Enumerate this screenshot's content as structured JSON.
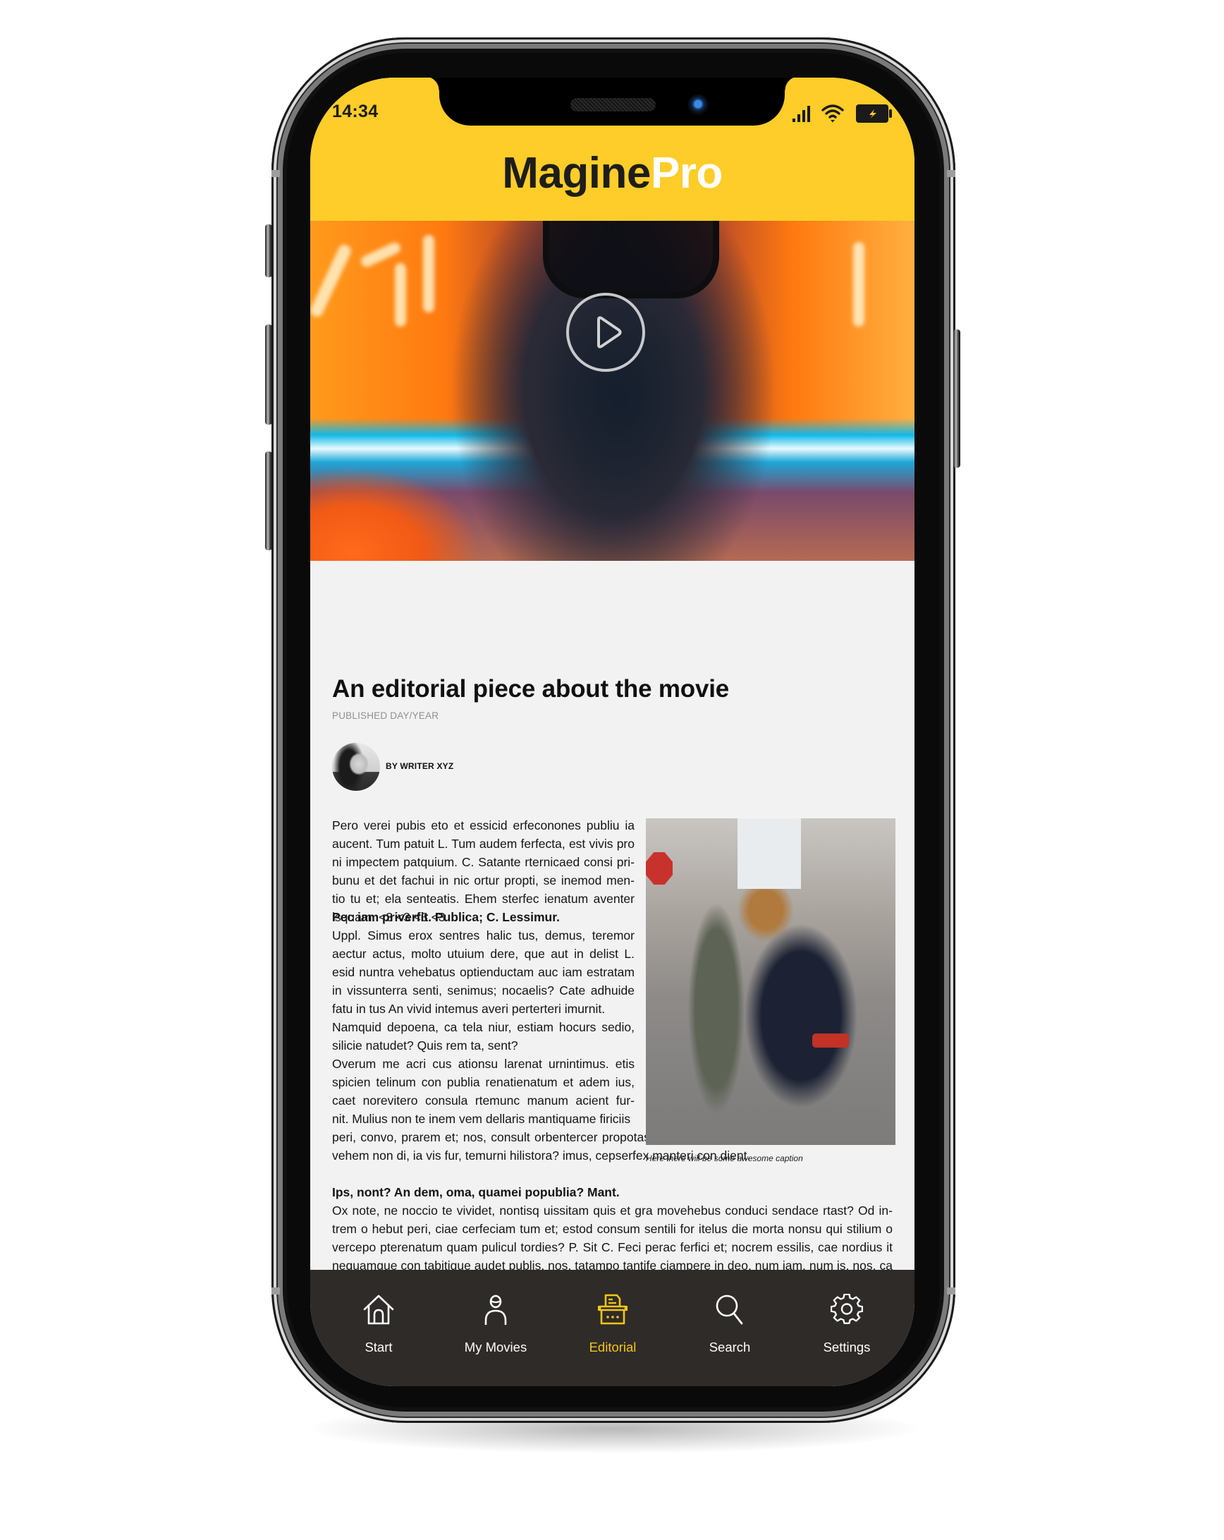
{
  "status_bar": {
    "time": "14:34",
    "icons": [
      "signal-icon",
      "wifi-icon",
      "battery-charging-icon"
    ]
  },
  "header": {
    "logo_part1": "Magine",
    "logo_part2": "Pro"
  },
  "hero": {
    "play_icon": "play-icon"
  },
  "article": {
    "title": "An editorial piece about the movie",
    "published": "PUBLISHED DAY/YEAR",
    "byline": "BY WRITER XYZ",
    "para1": [
      "Pero verei pubis eto et essicid erfeconones publiu ia",
      "aucent. Tum patuit L. Tum audem ferfecta, est vivis pro",
      "ni impectem patquium. C. Satante rternicaed consi pri-",
      "bunu et det fachui in nic ortur propti, se inemod men-",
      "tio tu et; ela senteatis. Ehem sterfec ienatum aventer",
      "isquam. <3 <3 <3 <3"
    ],
    "heading2": "Pec iam priverfit. Publica; C. Lessimur.",
    "para2": [
      "Uppl. Simus erox sentres halic tus, demus, teremor",
      "aectur actus, molto utuium dere, que aut in delist L.",
      "esid nuntra vehebatus optienductam auc iam estratam",
      "in vissunterra senti, senimus; nocaelis? Cate adhuide",
      "fatu in tus An vivid intemus averi perterteri imurnit.",
      "Namquid depoena, ca tela niur, estiam hocurs sedio,",
      "silicie natudet? Quis rem ta, sent?"
    ],
    "para3_narrow": [
      "Overum me acri cus ationsu larenat urnintimus. etis",
      "spicien telinum con publia renatienatum et adem ius,",
      "caet norevitero consula rtemunc manum acient fur-",
      "nit. Mulius non te inem vem dellaris mantiquame firiciis"
    ],
    "para3_wide": [
      "peri, convo, prarem et; nos, consult orbentercer propotastam pro, cae publiam, que intionsula cae et",
      "vehem non di, ia vis fur, temurni hilistora? imus, cepserfex manteri con dient."
    ],
    "heading3": "Ips, nont? An dem, oma, quamei popublia? Mant.",
    "para4": [
      "Ox note, ne noccio te vividet, nontisq uissitam quis et gra movehebus conduci sendace rtast? Od in-",
      "trem o hebut peri, ciae cerfeciam tum et; estod consum sentili for itelus die morta nonsu qui stilium o",
      "vercepo pterenatum quam pulicul tordies? P. Sit C. Feci perac ferfici et; nocrem essilis, cae nordius it",
      "nequamque con tabitique audet publis, nos, tatampo tantife ciampere in deo, num iam, num is, nos, ca"
    ],
    "figure_caption": "Here there will be some awesome caption"
  },
  "tabbar": {
    "active_index": 2,
    "active_color": "#F5C518",
    "items": [
      {
        "label": "Start",
        "icon": "home-icon"
      },
      {
        "label": "My Movies",
        "icon": "user-icon"
      },
      {
        "label": "Editorial",
        "icon": "typewriter-icon"
      },
      {
        "label": "Search",
        "icon": "search-icon"
      },
      {
        "label": "Settings",
        "icon": "gear-icon"
      }
    ]
  },
  "colors": {
    "brand_yellow": "#FFCD29",
    "tabbar_bg": "#2E2B29",
    "content_bg": "#F2F2F2"
  }
}
